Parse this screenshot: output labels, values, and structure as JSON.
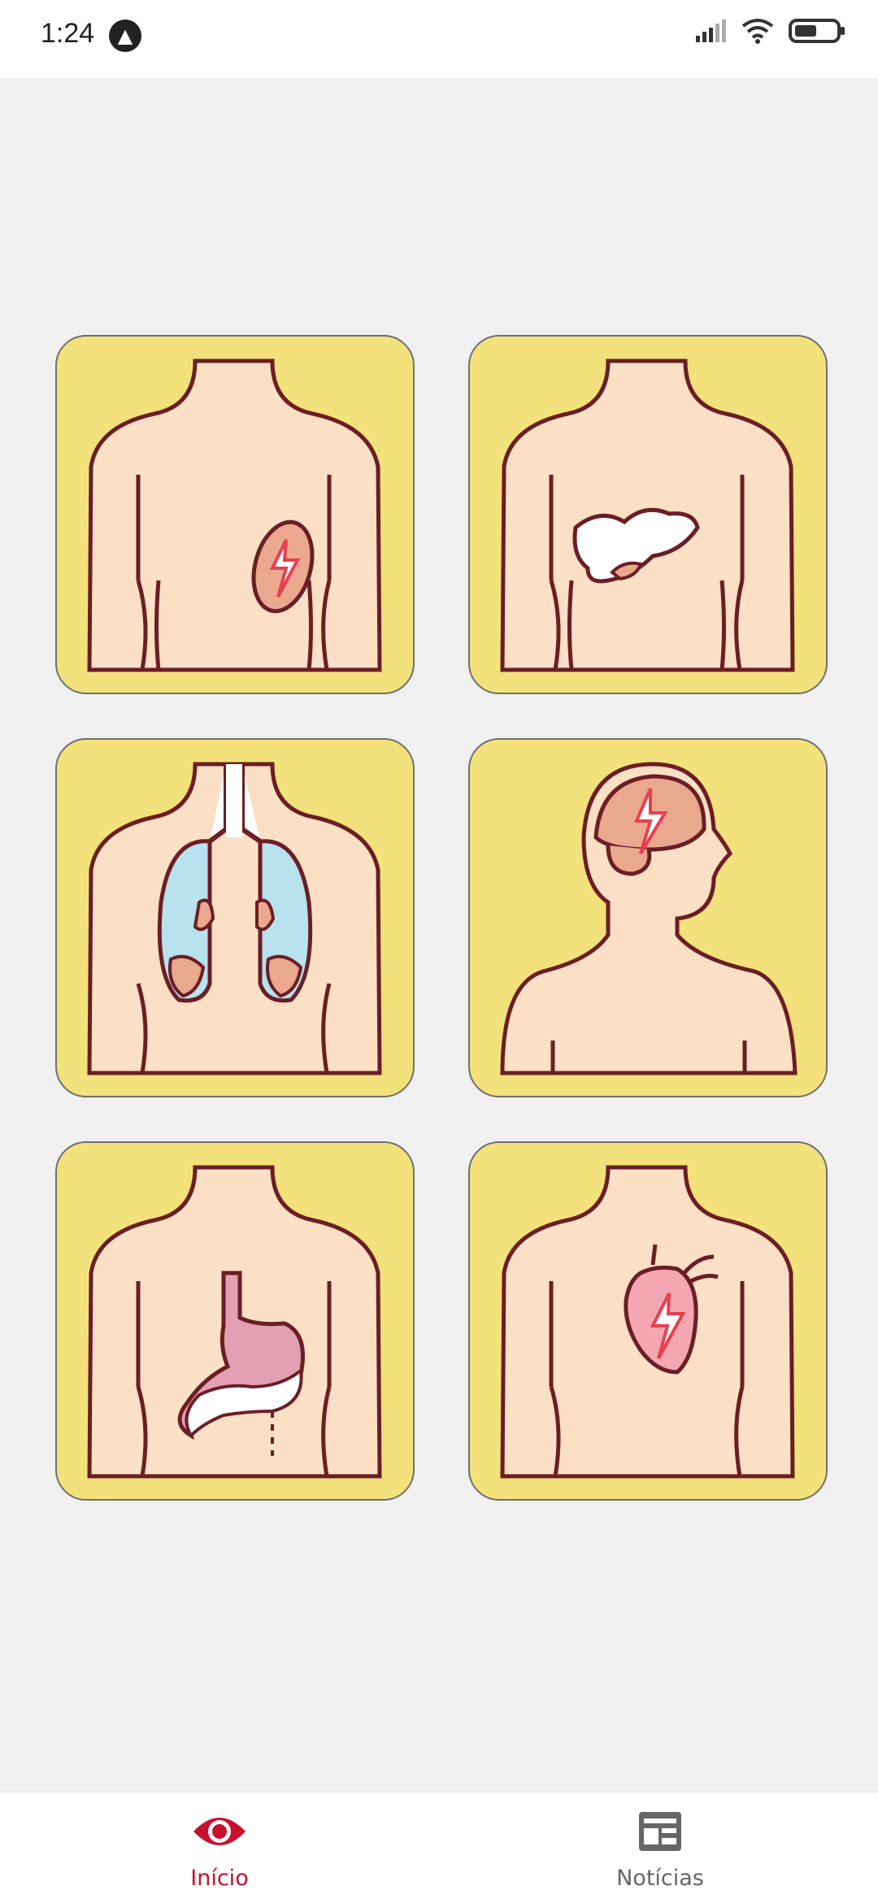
{
  "status_bar": {
    "time": "1:24",
    "app_indicator_icon": "app-notification-icon",
    "icons": [
      "signal-icon",
      "wifi-icon",
      "battery-icon"
    ]
  },
  "grid": {
    "cards": [
      {
        "icon": "spleen-body-icon"
      },
      {
        "icon": "liver-body-icon"
      },
      {
        "icon": "lungs-body-icon"
      },
      {
        "icon": "brain-head-icon"
      },
      {
        "icon": "stomach-body-icon"
      },
      {
        "icon": "heart-body-icon"
      }
    ]
  },
  "bottom_nav": {
    "items": [
      {
        "label": "Início",
        "icon": "eye-icon",
        "active": true
      },
      {
        "label": "Notícias",
        "icon": "newspaper-icon",
        "active": false
      }
    ]
  },
  "colors": {
    "card_bg": "#f3e27b",
    "skin": "#fbe0c6",
    "outline": "#6b1e24",
    "accent": "#c8102e"
  }
}
